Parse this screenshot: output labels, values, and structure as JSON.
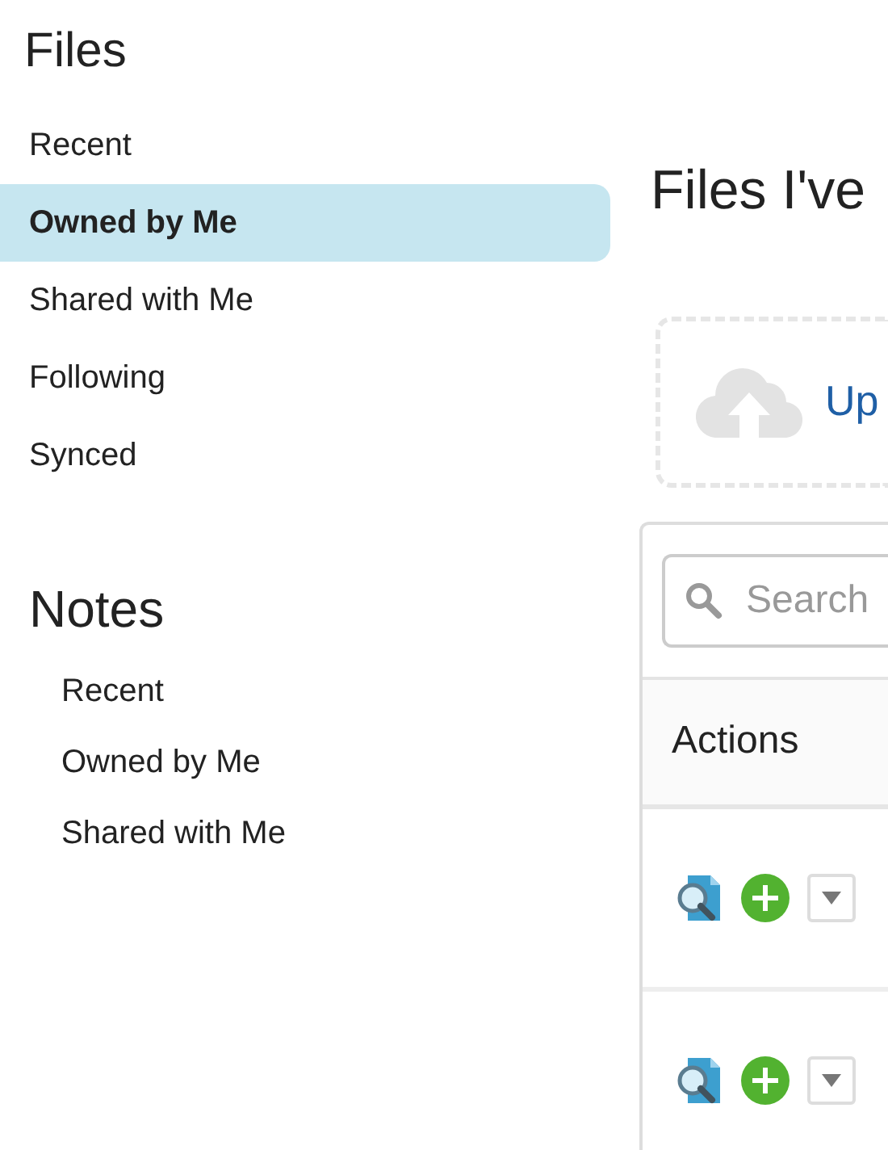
{
  "sidebar": {
    "title": "Files",
    "items": [
      {
        "label": "Recent",
        "selected": false
      },
      {
        "label": "Owned by Me",
        "selected": true
      },
      {
        "label": "Shared with Me",
        "selected": false
      },
      {
        "label": "Following",
        "selected": false
      },
      {
        "label": "Synced",
        "selected": false
      }
    ],
    "notes": {
      "title": "Notes",
      "items": [
        {
          "label": "Recent"
        },
        {
          "label": "Owned by Me"
        },
        {
          "label": "Shared with Me"
        }
      ]
    }
  },
  "main": {
    "heading": "Files I've",
    "upload": {
      "label": "Up"
    },
    "search": {
      "placeholder": "Search"
    },
    "table": {
      "columns": [
        "Actions"
      ],
      "rows": [
        {
          "kind": "file"
        },
        {
          "kind": "file"
        }
      ]
    }
  }
}
